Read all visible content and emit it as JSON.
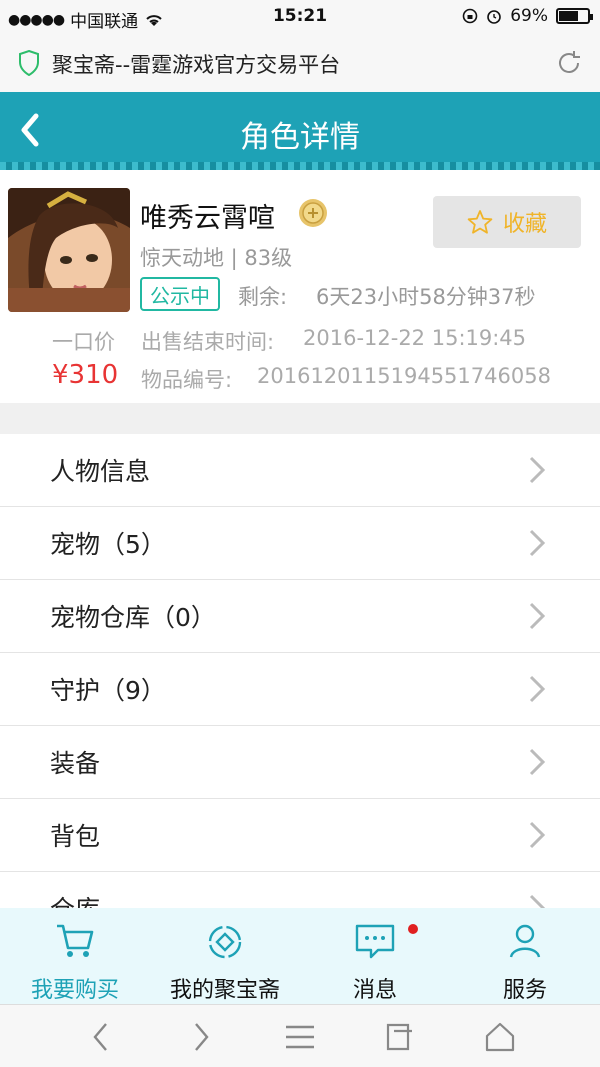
{
  "status_bar": {
    "carrier": "中国联通",
    "time": "15:21",
    "battery_text": "69%",
    "battery_level": 0.69
  },
  "browser": {
    "url_title": "聚宝斋--雷霆游戏官方交易平台"
  },
  "nav": {
    "title": "角色详情"
  },
  "item": {
    "name": "唯秀云霄喧",
    "server": "惊天动地 | 83级",
    "status": "公示中",
    "remain_label": "剩余:",
    "remain_value": "6天23小时58分钟37秒",
    "price_label": "一口价",
    "price": "¥310",
    "end_time_label": "出售结束时间:",
    "end_time_value": "2016-12-22 15:19:45",
    "code_label": "物品编号:",
    "code_value": "201612011519455174605​8",
    "fav_label": "收藏"
  },
  "menu": [
    {
      "label": "人物信息"
    },
    {
      "label": "宠物（5）"
    },
    {
      "label": "宠物仓库（0）"
    },
    {
      "label": "守护（9）"
    },
    {
      "label": "装备"
    },
    {
      "label": "背包"
    },
    {
      "label": "仓库"
    }
  ],
  "tabbar": {
    "tabs": [
      {
        "label": "我要购买",
        "icon": "cart-icon"
      },
      {
        "label": "我的聚宝斋",
        "icon": "target-icon"
      },
      {
        "label": "消息",
        "icon": "chat-icon"
      },
      {
        "label": "服务",
        "icon": "user-icon"
      }
    ]
  },
  "colors": {
    "accent": "#1ea2b6",
    "price": "#e83434",
    "badge": "#21b8a2",
    "favorite": "#f0b429"
  }
}
